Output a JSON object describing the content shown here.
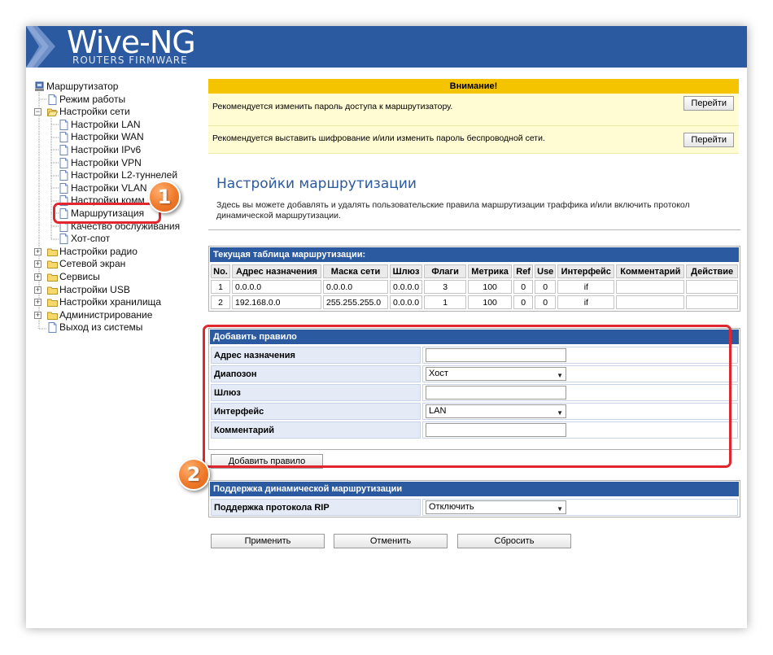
{
  "banner": {
    "brand": "Wive-NG",
    "subtitle": "ROUTERS FIRMWARE"
  },
  "tree": [
    {
      "label": "Маршрутизатор",
      "level": 0,
      "icon": "router-icon",
      "exp": ""
    },
    {
      "label": "Режим работы",
      "level": 1,
      "icon": "page-icon",
      "exp": ""
    },
    {
      "label": "Настройки сети",
      "level": 0,
      "icon": "folder-open-icon",
      "exp": "−"
    },
    {
      "label": "Настройки LAN",
      "level": 2,
      "icon": "page-icon",
      "exp": ""
    },
    {
      "label": "Настройки WAN",
      "level": 2,
      "icon": "page-icon",
      "exp": ""
    },
    {
      "label": "Настройки IPv6",
      "level": 2,
      "icon": "page-icon",
      "exp": ""
    },
    {
      "label": "Настройки VPN",
      "level": 2,
      "icon": "page-icon",
      "exp": ""
    },
    {
      "label": "Настройки L2-туннелей",
      "level": 2,
      "icon": "page-icon",
      "exp": ""
    },
    {
      "label": "Настройки VLAN",
      "level": 2,
      "icon": "page-icon",
      "exp": ""
    },
    {
      "label": "Настройки комм",
      "level": 2,
      "icon": "page-icon",
      "exp": ""
    },
    {
      "label": "Маршрутизация",
      "level": 2,
      "icon": "page-icon",
      "exp": ""
    },
    {
      "label": "Качество обслуживания",
      "level": 2,
      "icon": "page-icon",
      "exp": ""
    },
    {
      "label": "Хот-спот",
      "level": 2,
      "icon": "page-icon",
      "exp": ""
    },
    {
      "label": "Настройки радио",
      "level": 0,
      "icon": "folder-icon",
      "exp": "+"
    },
    {
      "label": "Сетевой экран",
      "level": 0,
      "icon": "folder-icon",
      "exp": "+"
    },
    {
      "label": "Сервисы",
      "level": 0,
      "icon": "folder-icon",
      "exp": "+"
    },
    {
      "label": "Настройки USB",
      "level": 0,
      "icon": "folder-icon",
      "exp": "+"
    },
    {
      "label": "Настройки хранилища",
      "level": 0,
      "icon": "folder-icon",
      "exp": "+"
    },
    {
      "label": "Администрирование",
      "level": 0,
      "icon": "folder-icon",
      "exp": "+"
    },
    {
      "label": "Выход из системы",
      "level": 1,
      "icon": "page-icon",
      "exp": ""
    }
  ],
  "callouts": {
    "one": "1",
    "two": "2"
  },
  "warning": {
    "title": "Внимание!",
    "rows": [
      {
        "text": "Рекомендуется изменить пароль доступа к маршрутизатору.",
        "button": "Перейти"
      },
      {
        "text": "Рекомендуется выставить шифрование и/или изменить пароль беспроводной сети.",
        "button": "Перейти"
      }
    ]
  },
  "page": {
    "title": "Настройки маршрутизации",
    "description": "Здесь вы можете добавлять и удалять пользовательские правила маршрутизации траффика и/или включить протокол динамической маршрутизации."
  },
  "route_table": {
    "title": "Текущая таблица маршрутизации:",
    "columns": [
      "No.",
      "Адрес назначения",
      "Маска сети",
      "Шлюз",
      "Флаги",
      "Метрика",
      "Ref",
      "Use",
      "Интерфейс",
      "Комментарий",
      "Действие"
    ],
    "rows": [
      [
        "1",
        "0.0.0.0",
        "0.0.0.0",
        "0.0.0.0",
        "3",
        "100",
        "0",
        "0",
        "if",
        "",
        ""
      ],
      [
        "2",
        "192.168.0.0",
        "255.255.255.0",
        "0.0.0.0",
        "1",
        "100",
        "0",
        "0",
        "if",
        "",
        ""
      ]
    ]
  },
  "add_rule": {
    "title": "Добавить правило",
    "fields": {
      "dest_label": "Адрес назначения",
      "dest_value": "",
      "range_label": "Диапозон",
      "range_value": "Хост",
      "gw_label": "Шлюз",
      "gw_value": "",
      "iface_label": "Интерфейс",
      "iface_value": "LAN",
      "comment_label": "Комментарий",
      "comment_value": ""
    },
    "button": "Добавить правило"
  },
  "dynamic": {
    "title": "Поддержка динамической маршрутизации",
    "rip_label": "Поддержка протокола RIP",
    "rip_value": "Отключить"
  },
  "actions": {
    "apply": "Применить",
    "cancel": "Отменить",
    "reset": "Сбросить"
  },
  "colors": {
    "accent": "#2c5aa0",
    "warning": "#f5c400",
    "callout": "#e1262d",
    "badge": "#f07a2a"
  }
}
